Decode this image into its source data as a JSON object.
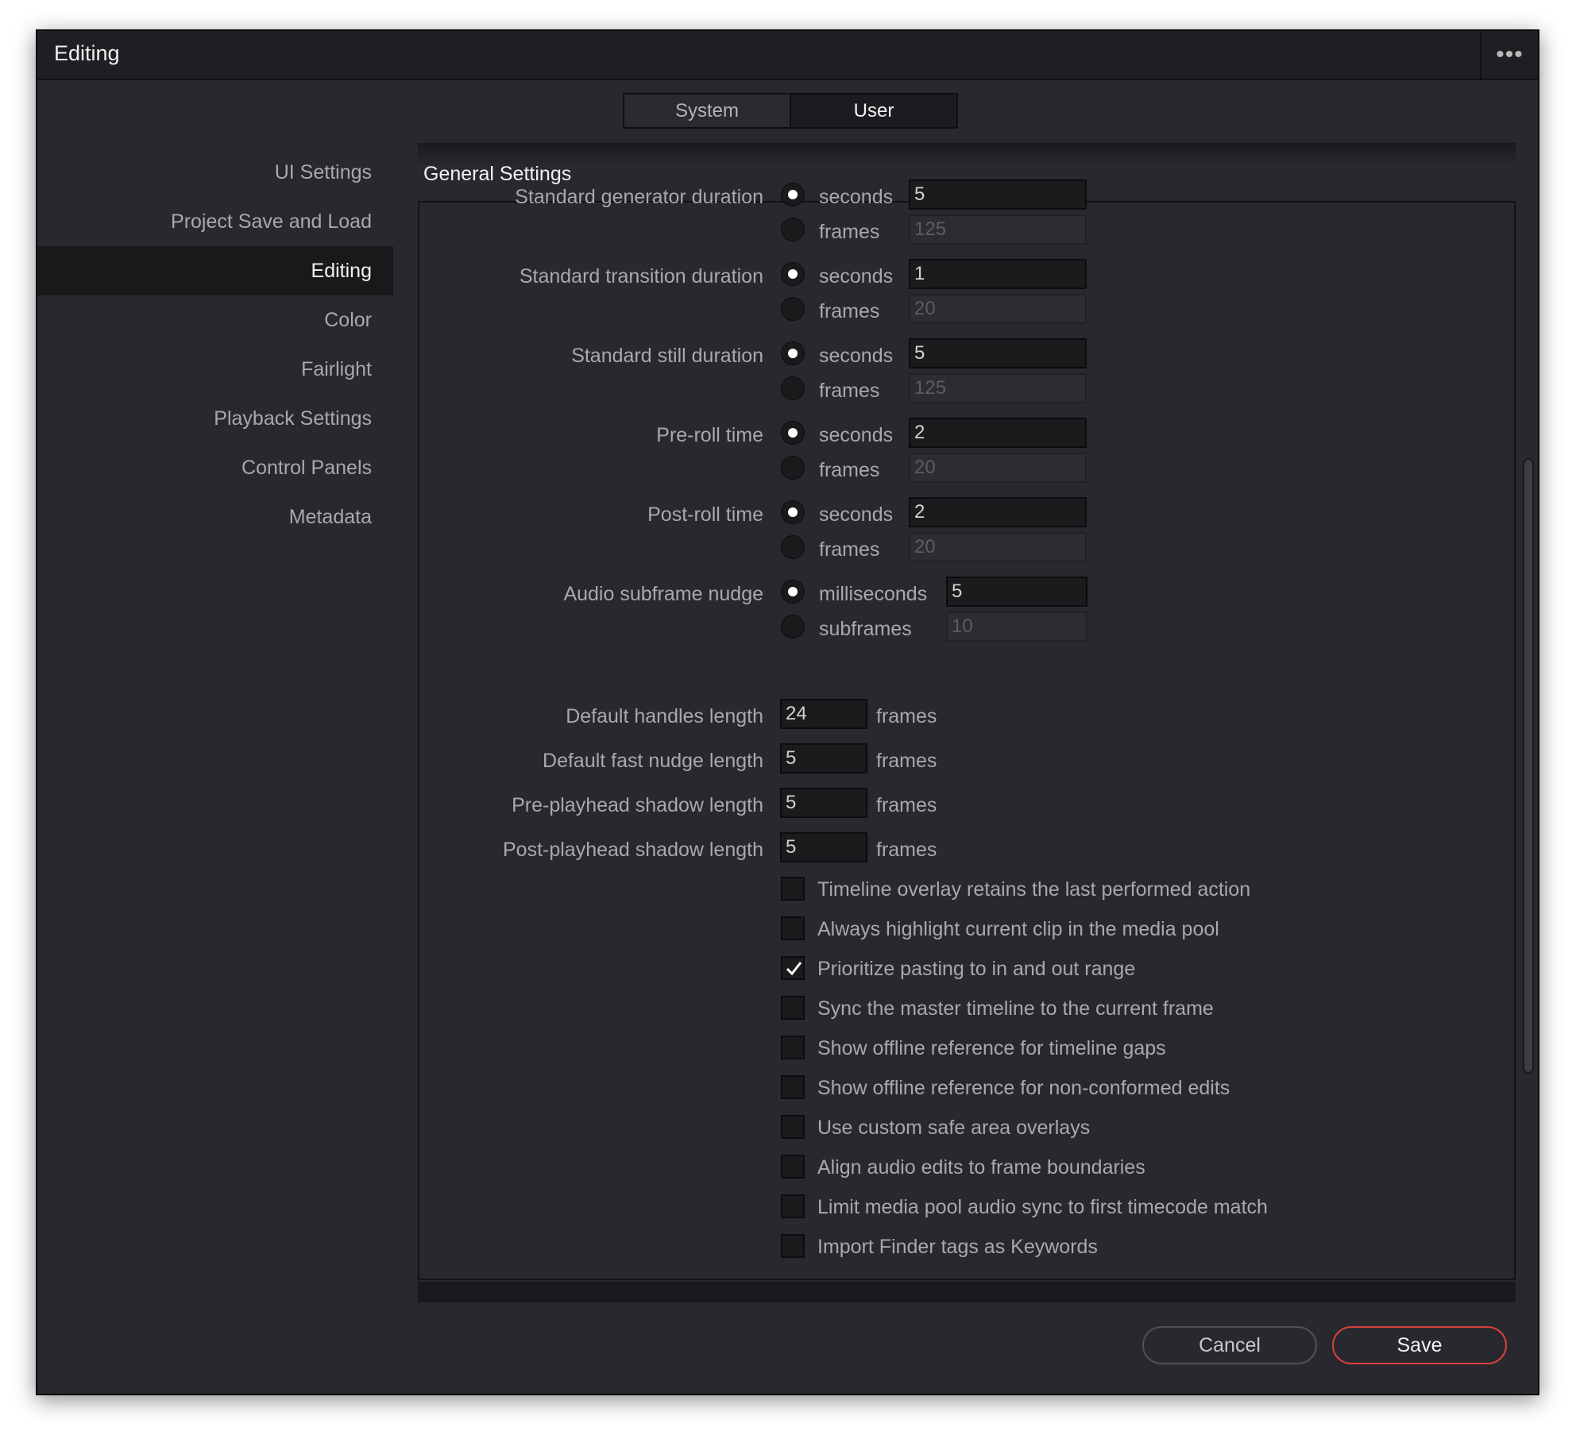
{
  "window": {
    "title": "Editing"
  },
  "tabs": [
    {
      "label": "System",
      "active": false
    },
    {
      "label": "User",
      "active": true
    }
  ],
  "sidebar": {
    "items": [
      {
        "label": "UI Settings",
        "active": false
      },
      {
        "label": "Project Save and Load",
        "active": false
      },
      {
        "label": "Editing",
        "active": true
      },
      {
        "label": "Color",
        "active": false
      },
      {
        "label": "Fairlight",
        "active": false
      },
      {
        "label": "Playback Settings",
        "active": false
      },
      {
        "label": "Control Panels",
        "active": false
      },
      {
        "label": "Metadata",
        "active": false
      }
    ]
  },
  "section": {
    "title": "General Settings"
  },
  "durations": [
    {
      "label": "Standard generator duration",
      "options": [
        {
          "unit": "seconds",
          "value": "5",
          "selected": true
        },
        {
          "unit": "frames",
          "value": "125",
          "selected": false
        }
      ]
    },
    {
      "label": "Standard transition duration",
      "options": [
        {
          "unit": "seconds",
          "value": "1",
          "selected": true
        },
        {
          "unit": "frames",
          "value": "20",
          "selected": false
        }
      ]
    },
    {
      "label": "Standard still duration",
      "options": [
        {
          "unit": "seconds",
          "value": "5",
          "selected": true
        },
        {
          "unit": "frames",
          "value": "125",
          "selected": false
        }
      ]
    },
    {
      "label": "Pre-roll time",
      "options": [
        {
          "unit": "seconds",
          "value": "2",
          "selected": true
        },
        {
          "unit": "frames",
          "value": "20",
          "selected": false
        }
      ]
    },
    {
      "label": "Post-roll time",
      "options": [
        {
          "unit": "seconds",
          "value": "2",
          "selected": true
        },
        {
          "unit": "frames",
          "value": "20",
          "selected": false
        }
      ]
    },
    {
      "label": "Audio subframe nudge",
      "options": [
        {
          "unit": "milliseconds",
          "value": "5",
          "selected": true
        },
        {
          "unit": "subframes",
          "value": "10",
          "selected": false
        }
      ]
    }
  ],
  "lengths": [
    {
      "label": "Default handles length",
      "value": "24",
      "unit": "frames"
    },
    {
      "label": "Default fast nudge length",
      "value": "5",
      "unit": "frames"
    },
    {
      "label": "Pre-playhead shadow length",
      "value": "5",
      "unit": "frames"
    },
    {
      "label": "Post-playhead shadow length",
      "value": "5",
      "unit": "frames"
    }
  ],
  "checkboxes": [
    {
      "label": "Timeline overlay retains the last performed action",
      "checked": false
    },
    {
      "label": "Always highlight current clip in the media pool",
      "checked": false
    },
    {
      "label": "Prioritize pasting to in and out range",
      "checked": true
    },
    {
      "label": "Sync the master timeline to the current frame",
      "checked": false
    },
    {
      "label": "Show offline reference for timeline gaps",
      "checked": false
    },
    {
      "label": "Show offline reference for non-conformed edits",
      "checked": false
    },
    {
      "label": "Use custom safe area overlays",
      "checked": false
    },
    {
      "label": "Align audio edits to frame boundaries",
      "checked": false
    },
    {
      "label": "Limit media pool audio sync to first timecode match",
      "checked": false
    },
    {
      "label": "Import Finder tags as Keywords",
      "checked": false
    }
  ],
  "footer": {
    "cancel_label": "Cancel",
    "save_label": "Save"
  },
  "icons": {
    "more": "more-horizontal-icon",
    "check": "checkmark-icon"
  },
  "colors": {
    "accent": "#d5423a",
    "background": "#28282e",
    "text": "#a9a9ab"
  }
}
